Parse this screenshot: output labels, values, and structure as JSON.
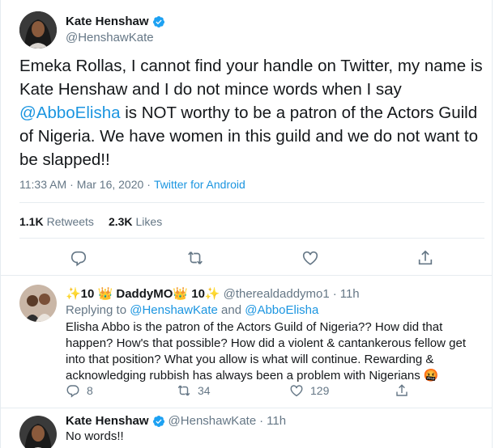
{
  "main_tweet": {
    "display_name": "Kate Henshaw",
    "handle": "@HenshawKate",
    "text_part1": "Emeka Rollas, I cannot find your handle on Twitter, my name is Kate Henshaw and I do not mince words when I say ",
    "mention": "@AbboElisha",
    "text_part2": " is NOT worthy to be a patron of the Actors Guild of Nigeria. We have women in this guild and we do not want to be slapped!!",
    "time": "11:33 AM",
    "sep": "·",
    "date": "Mar 16, 2020",
    "app": "Twitter for Android",
    "retweets_count": "1.1K",
    "retweets_label": "Retweets",
    "likes_count": "2.3K",
    "likes_label": "Likes",
    "action_icons": [
      "reply-icon",
      "retweet-icon",
      "like-icon",
      "share-icon"
    ]
  },
  "reply1": {
    "display_name": "✨10 👑 DaddyMO👑 10✨",
    "handle": "@therealdaddymo1",
    "sep": "·",
    "time": "11h",
    "replying_prefix": "Replying to ",
    "replying_to_1": "@HenshawKate",
    "replying_and": " and ",
    "replying_to_2": "@AbboElisha",
    "text": "Elisha Abbo is the patron of the Actors Guild of Nigeria?? How did that happen? How's that possible? How did a violent & cantankerous fellow get into that position? What you allow is what will continue. Rewarding & acknowledging rubbish has always been a problem with Nigerians 🤬",
    "reply_count": "8",
    "retweet_count": "34",
    "like_count": "129"
  },
  "reply2": {
    "display_name": "Kate Henshaw",
    "handle": "@HenshawKate",
    "sep": "·",
    "time": "11h",
    "text": "No words!!"
  },
  "colors": {
    "link": "#1b95e0",
    "secondary_text": "#657786",
    "primary_text": "#14171a",
    "divider": "#e6ecf0"
  }
}
